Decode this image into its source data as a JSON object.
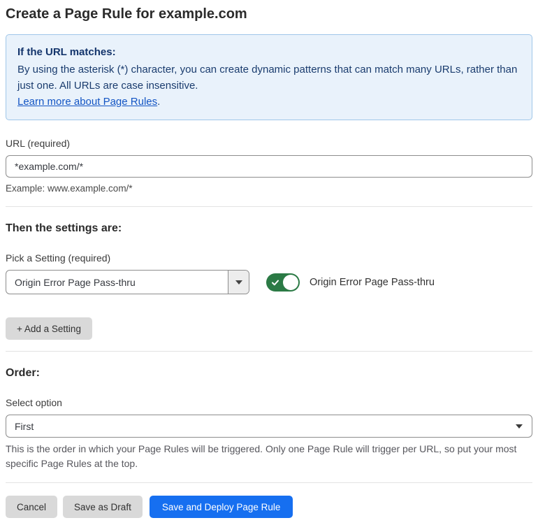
{
  "page": {
    "title": "Create a Page Rule for example.com"
  },
  "info_box": {
    "heading": "If the URL matches:",
    "body": "By using the asterisk (*) character, you can create dynamic patterns that can match many URLs, rather than just one. All URLs are case insensitive.",
    "link_label": "Learn more about Page Rules",
    "link_suffix": "."
  },
  "url_field": {
    "label": "URL (required)",
    "value": "*example.com/*",
    "helper": "Example: www.example.com/*"
  },
  "settings_section": {
    "heading": "Then the settings are:",
    "picker_label": "Pick a Setting (required)",
    "picker_value": "Origin Error Page Pass-thru",
    "toggle_label": "Origin Error Page Pass-thru",
    "toggle_state": "on",
    "add_setting_label": "+ Add a Setting"
  },
  "order_section": {
    "heading": "Order:",
    "select_label": "Select option",
    "select_value": "First",
    "helper": "This is the order in which your Page Rules will be triggered. Only one Page Rule will trigger per URL, so put your most specific Page Rules at the top."
  },
  "footer": {
    "cancel_label": "Cancel",
    "save_draft_label": "Save as Draft",
    "save_deploy_label": "Save and Deploy Page Rule"
  },
  "colors": {
    "info_background": "#e9f2fb",
    "info_border": "#9fc6e9",
    "info_text": "#1a3c6e",
    "link_blue": "#1355c4",
    "toggle_green": "#2b7a45",
    "primary_button_blue": "#166ff0",
    "secondary_button_gray": "#d9d9d9",
    "divider_gray": "#e3e3e3",
    "text_dark": "#313131"
  }
}
